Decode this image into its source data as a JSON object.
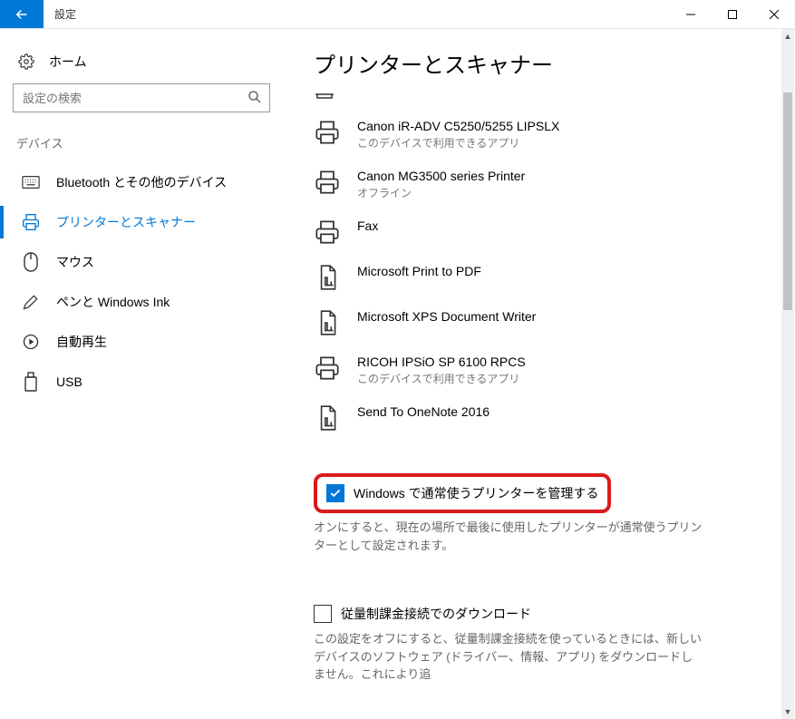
{
  "window": {
    "title": "設定"
  },
  "sidebar": {
    "home": "ホーム",
    "search_placeholder": "設定の検索",
    "section": "デバイス",
    "items": [
      {
        "label": "Bluetooth とその他のデバイス"
      },
      {
        "label": "プリンターとスキャナー"
      },
      {
        "label": "マウス"
      },
      {
        "label": "ペンと Windows Ink"
      },
      {
        "label": "自動再生"
      },
      {
        "label": "USB"
      }
    ]
  },
  "main": {
    "title": "プリンターとスキャナー",
    "printers": [
      {
        "name": "Canon iR-ADV C5250/5255 LIPSLX",
        "status": "このデバイスで利用できるアプリ",
        "icon": "printer"
      },
      {
        "name": "Canon MG3500 series Printer",
        "status": "オフライン",
        "icon": "printer"
      },
      {
        "name": "Fax",
        "status": "",
        "icon": "printer"
      },
      {
        "name": "Microsoft Print to PDF",
        "status": "",
        "icon": "doc"
      },
      {
        "name": "Microsoft XPS Document Writer",
        "status": "",
        "icon": "doc"
      },
      {
        "name": "RICOH IPSiO SP 6100 RPCS",
        "status": "このデバイスで利用できるアプリ",
        "icon": "printer"
      },
      {
        "name": "Send To OneNote 2016",
        "status": "",
        "icon": "doc"
      }
    ],
    "option1": {
      "label": "Windows で通常使うプリンターを管理する",
      "desc": "オンにすると、現在の場所で最後に使用したプリンターが通常使うプリンターとして設定されます。",
      "checked": true
    },
    "option2": {
      "label": "従量制課金接続でのダウンロード",
      "desc": "この設定をオフにすると、従量制課金接続を使っているときには、新しいデバイスのソフトウェア (ドライバー、情報、アプリ) をダウンロードしません。これにより追",
      "checked": false
    }
  }
}
